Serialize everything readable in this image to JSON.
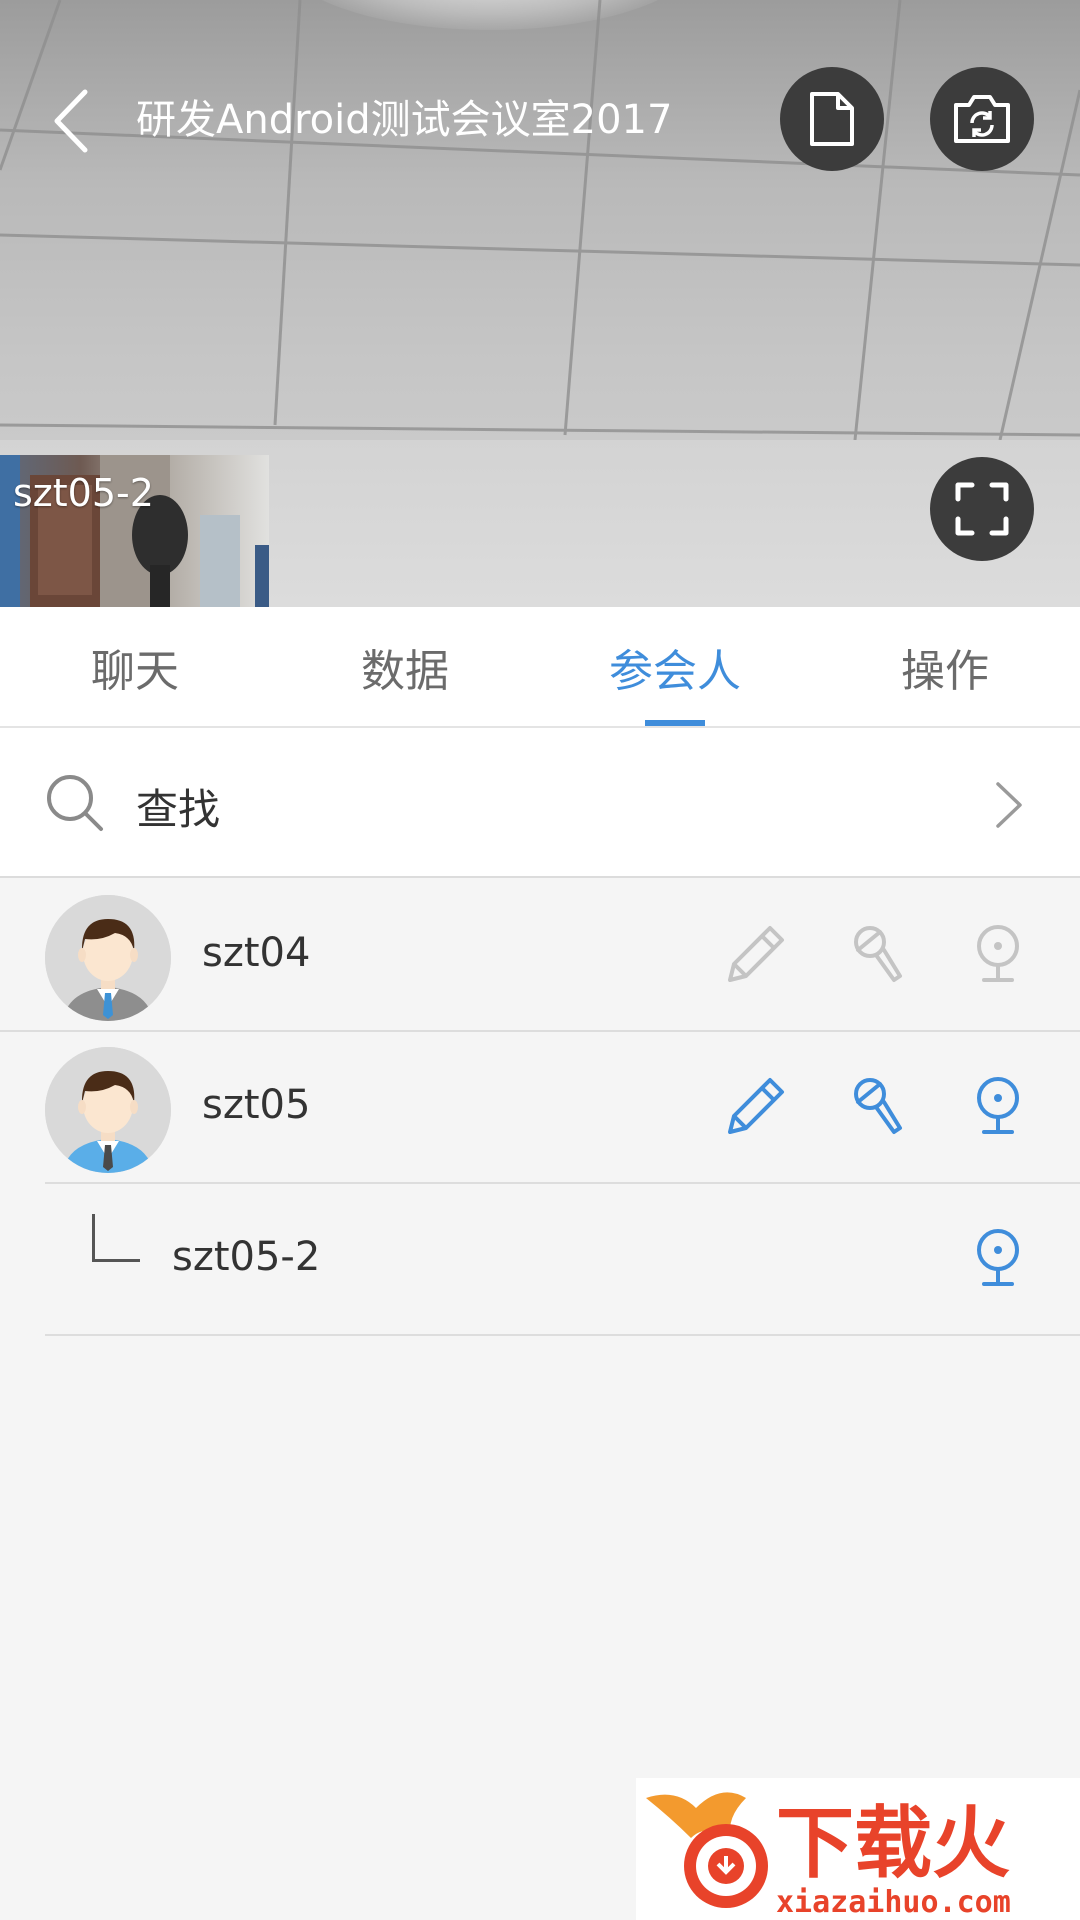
{
  "header": {
    "title": "研发Android测试会议室2017"
  },
  "video": {
    "thumbnail_label": "szt05-2"
  },
  "tabs": [
    {
      "label": "聊天",
      "active": false
    },
    {
      "label": "数据",
      "active": false
    },
    {
      "label": "参会人",
      "active": true
    },
    {
      "label": "操作",
      "active": false
    }
  ],
  "search": {
    "label": "查找"
  },
  "participants": [
    {
      "name": "szt04",
      "icons": [
        "pencil-icon",
        "microphone-icon",
        "camera-icon"
      ],
      "active": false
    },
    {
      "name": "szt05",
      "icons": [
        "pencil-icon",
        "microphone-icon",
        "camera-icon"
      ],
      "active": true
    }
  ],
  "sub_devices": [
    {
      "name": "szt05-2",
      "icons": [
        "camera-icon"
      ],
      "active": true
    }
  ],
  "watermark": {
    "brand": "下载火",
    "domain": "xiazaihuo.com"
  },
  "colors": {
    "accent": "#3f8ddb",
    "inactive_icon": "#c4c4c4",
    "button_bg": "#3c3c3c"
  }
}
